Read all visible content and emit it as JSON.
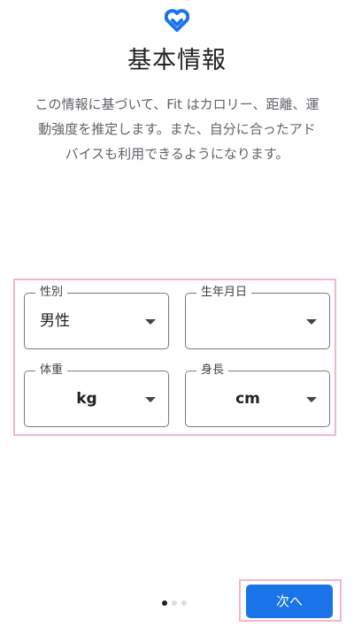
{
  "header": {
    "title": "基本情報",
    "description_lines": [
      "この情報に基づいて、Fit はカロリー、距離、運",
      "動強度を推定します。また、自分に合ったアド",
      "バイスも利用できるようになります。"
    ]
  },
  "form": {
    "gender": {
      "label": "性別",
      "value": "男性"
    },
    "birthdate": {
      "label": "生年月日",
      "value": ""
    },
    "weight": {
      "label": "体重",
      "unit": "kg"
    },
    "height": {
      "label": "身長",
      "unit": "cm"
    }
  },
  "pager": {
    "total": 3,
    "current": 1
  },
  "footer": {
    "next_label": "次へ"
  },
  "colors": {
    "accent": "#1a73e8",
    "logo": "#1a73e8",
    "highlight": "#f3b6cf"
  },
  "icons": {
    "logo": "google-fit-heart-icon",
    "dropdown": "dropdown-arrow-icon"
  }
}
